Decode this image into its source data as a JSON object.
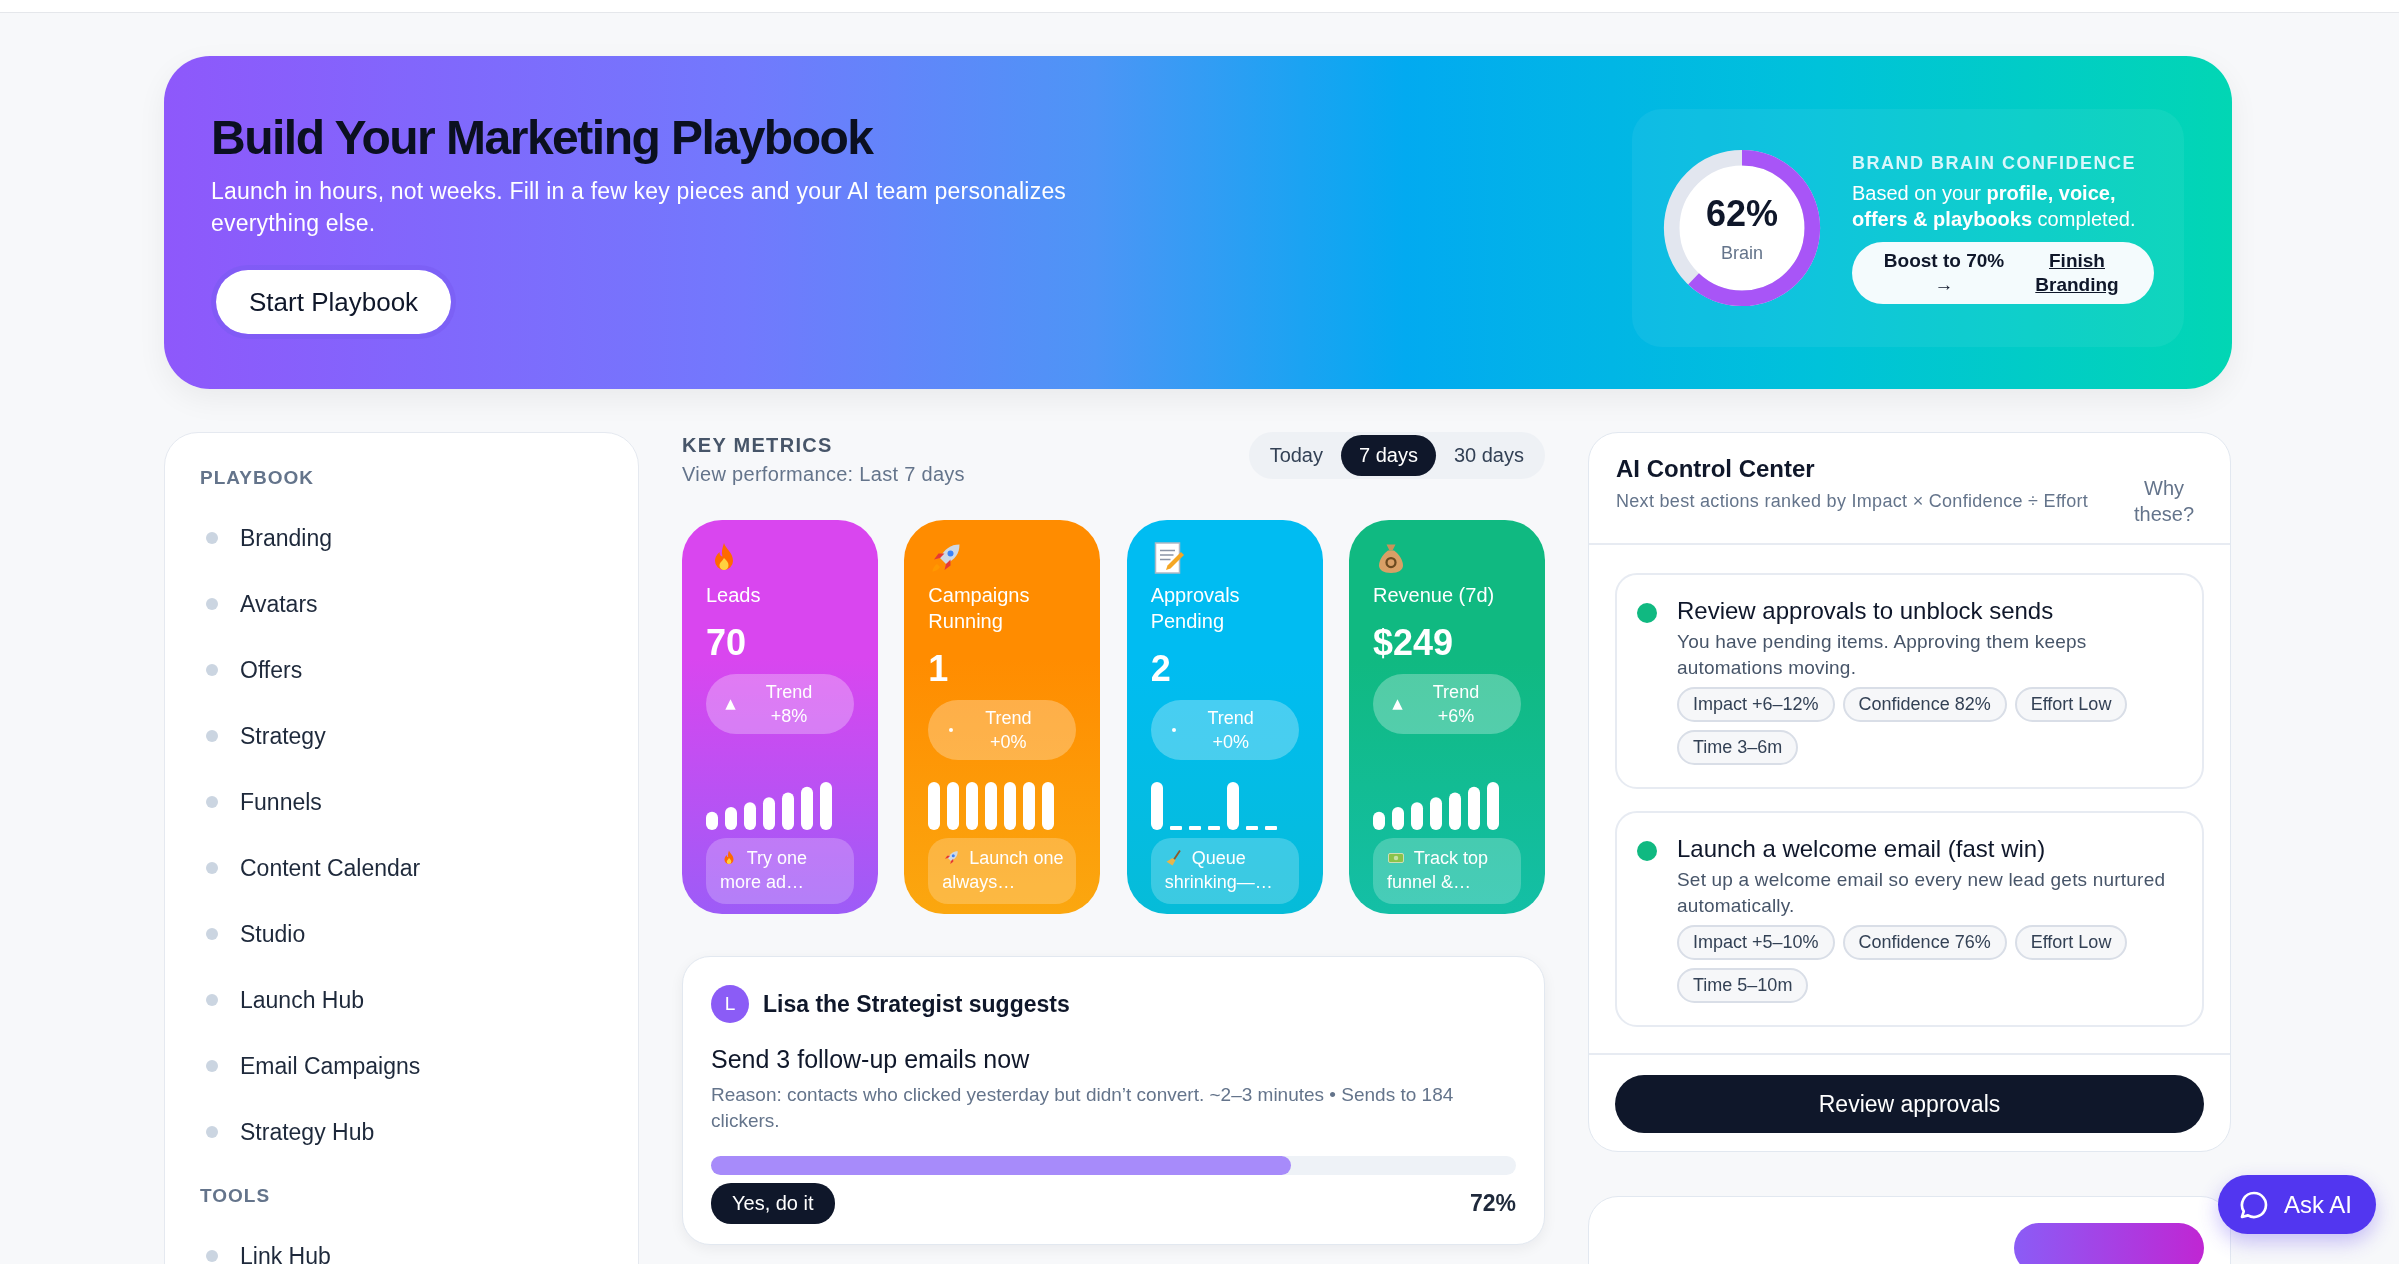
{
  "hero": {
    "title": "Build Your Marketing Playbook",
    "subtitle": "Launch in hours, not weeks. Fill in a few key pieces and your AI team personalizes everything else.",
    "button": "Start Playbook",
    "confidence": {
      "level": 0.62,
      "value": "62%",
      "caption": "Brain",
      "heading": "BRAND BRAIN CONFIDENCE",
      "text": "Based on your **profile, voice, offers & playbooks** completed.",
      "boost": "Boost to 70% →",
      "link": "Finish Branding"
    }
  },
  "sidebar": {
    "sections": [
      {
        "heading": "PLAYBOOK",
        "items": [
          "Branding",
          "Avatars",
          "Offers",
          "Strategy",
          "Funnels",
          "Content Calendar",
          "Studio",
          "Launch Hub",
          "Email Campaigns",
          "Strategy Hub"
        ]
      },
      {
        "heading": "TOOLS",
        "items": [
          "Link Hub"
        ]
      }
    ]
  },
  "metrics": {
    "heading": "KEY METRICS",
    "subtitle": "View performance: Last 7 days",
    "ranges": [
      {
        "label": "Today",
        "selected": false
      },
      {
        "label": "7 days",
        "selected": true
      },
      {
        "label": "30 days",
        "selected": false
      }
    ],
    "cards": [
      {
        "kind": "leads",
        "color": "#d946ef",
        "label": "Leads",
        "value": "70",
        "rising": true,
        "trend": "Trend +8%",
        "tip": "Try one more ad…"
      },
      {
        "kind": "campaigns",
        "color": "#ff8c00",
        "label": "Campaigns Running",
        "value": "1",
        "rising": false,
        "trend": "Trend +0%",
        "tip": "Launch one always…"
      },
      {
        "kind": "approvals",
        "color": "#00bcf2",
        "label": "Approvals Pending",
        "value": "2",
        "rising": false,
        "trend": "Trend +0%",
        "tip": "Queue shrinking—…"
      },
      {
        "kind": "revenue",
        "color": "#10b981",
        "label": "Revenue (7d)",
        "value": "$249",
        "rising": true,
        "trend": "Trend +6%",
        "tip": "Track top funnel &…"
      }
    ]
  },
  "suggestion": {
    "avatar": "L",
    "title": "Lisa the Strategist suggests",
    "headline": "Send 3 follow-up emails now",
    "reason": "Reason: contacts who clicked yesterday but didn’t convert. ~2–3 minutes • Sends to 184 clickers.",
    "level": 0.72,
    "button": "Yes, do it",
    "percent": "72%"
  },
  "control_center": {
    "title": "AI Control Center",
    "subtitle": "Next best actions ranked by Impact × Confidence ÷ Effort",
    "why": "Why these?",
    "actions": [
      {
        "color": "#10b981",
        "title": "Review approvals to unblock sends",
        "text": "You have pending items. Approving them keeps automations moving.",
        "chips": [
          "Impact +6–12%",
          "Confidence 82%",
          "Effort Low",
          "Time 3–6m"
        ]
      },
      {
        "color": "#10b981",
        "title": "Launch a welcome email (fast win)",
        "text": "Set up a welcome email so every new lead gets nurtured automatically.",
        "chips": [
          "Impact +5–10%",
          "Confidence 76%",
          "Effort Low",
          "Time 5–10m"
        ]
      }
    ],
    "button": "Review approvals"
  },
  "ask_ai": "Ask AI"
}
